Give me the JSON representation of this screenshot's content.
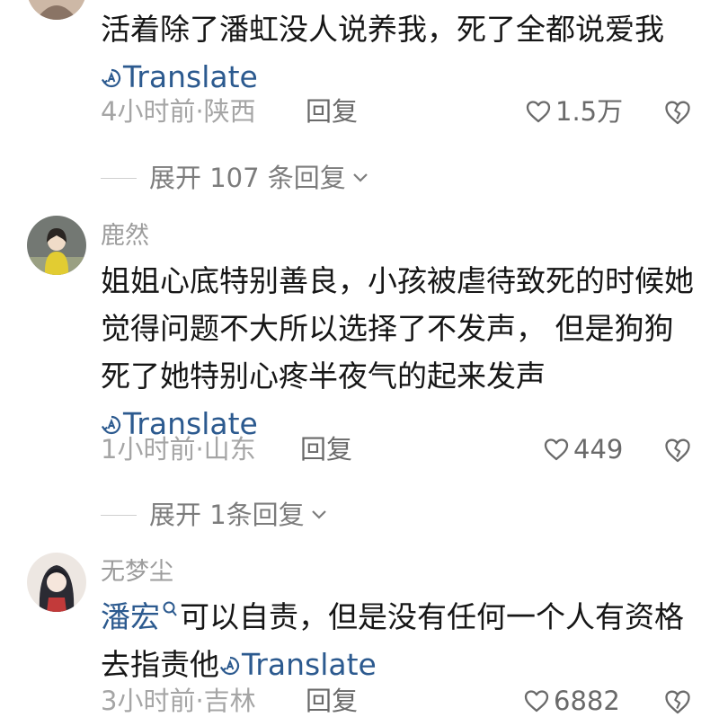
{
  "comments": [
    {
      "username": "",
      "text": "活着除了潘虹没人说养我，死了全都说爱我",
      "translate": "Translate",
      "time": "4小时前",
      "location": "陕西",
      "reply": "回复",
      "likes": "1.5万",
      "expand": "展开 107 条回复"
    },
    {
      "username": "鹿然",
      "text": "姐姐心底特别善良，小孩被虐待致死的时候她觉得问题不大所以选择了不发声， 但是狗狗死了她特别心疼半夜气的起来发声",
      "translate": "Translate",
      "time": "1小时前",
      "location": "山东",
      "reply": "回复",
      "likes": "449",
      "expand": "展开 1条回复"
    },
    {
      "username": "无梦尘",
      "mention": "潘宏",
      "text": "可以自责，但是没有任何一个人有资格去指责他",
      "translate": "Translate",
      "time": "3小时前",
      "location": "吉林",
      "reply": "回复",
      "likes": "6882"
    }
  ],
  "colors": {
    "link": "#2c5a8f",
    "meta": "#a5a5a5",
    "username": "#9c9c9c"
  }
}
